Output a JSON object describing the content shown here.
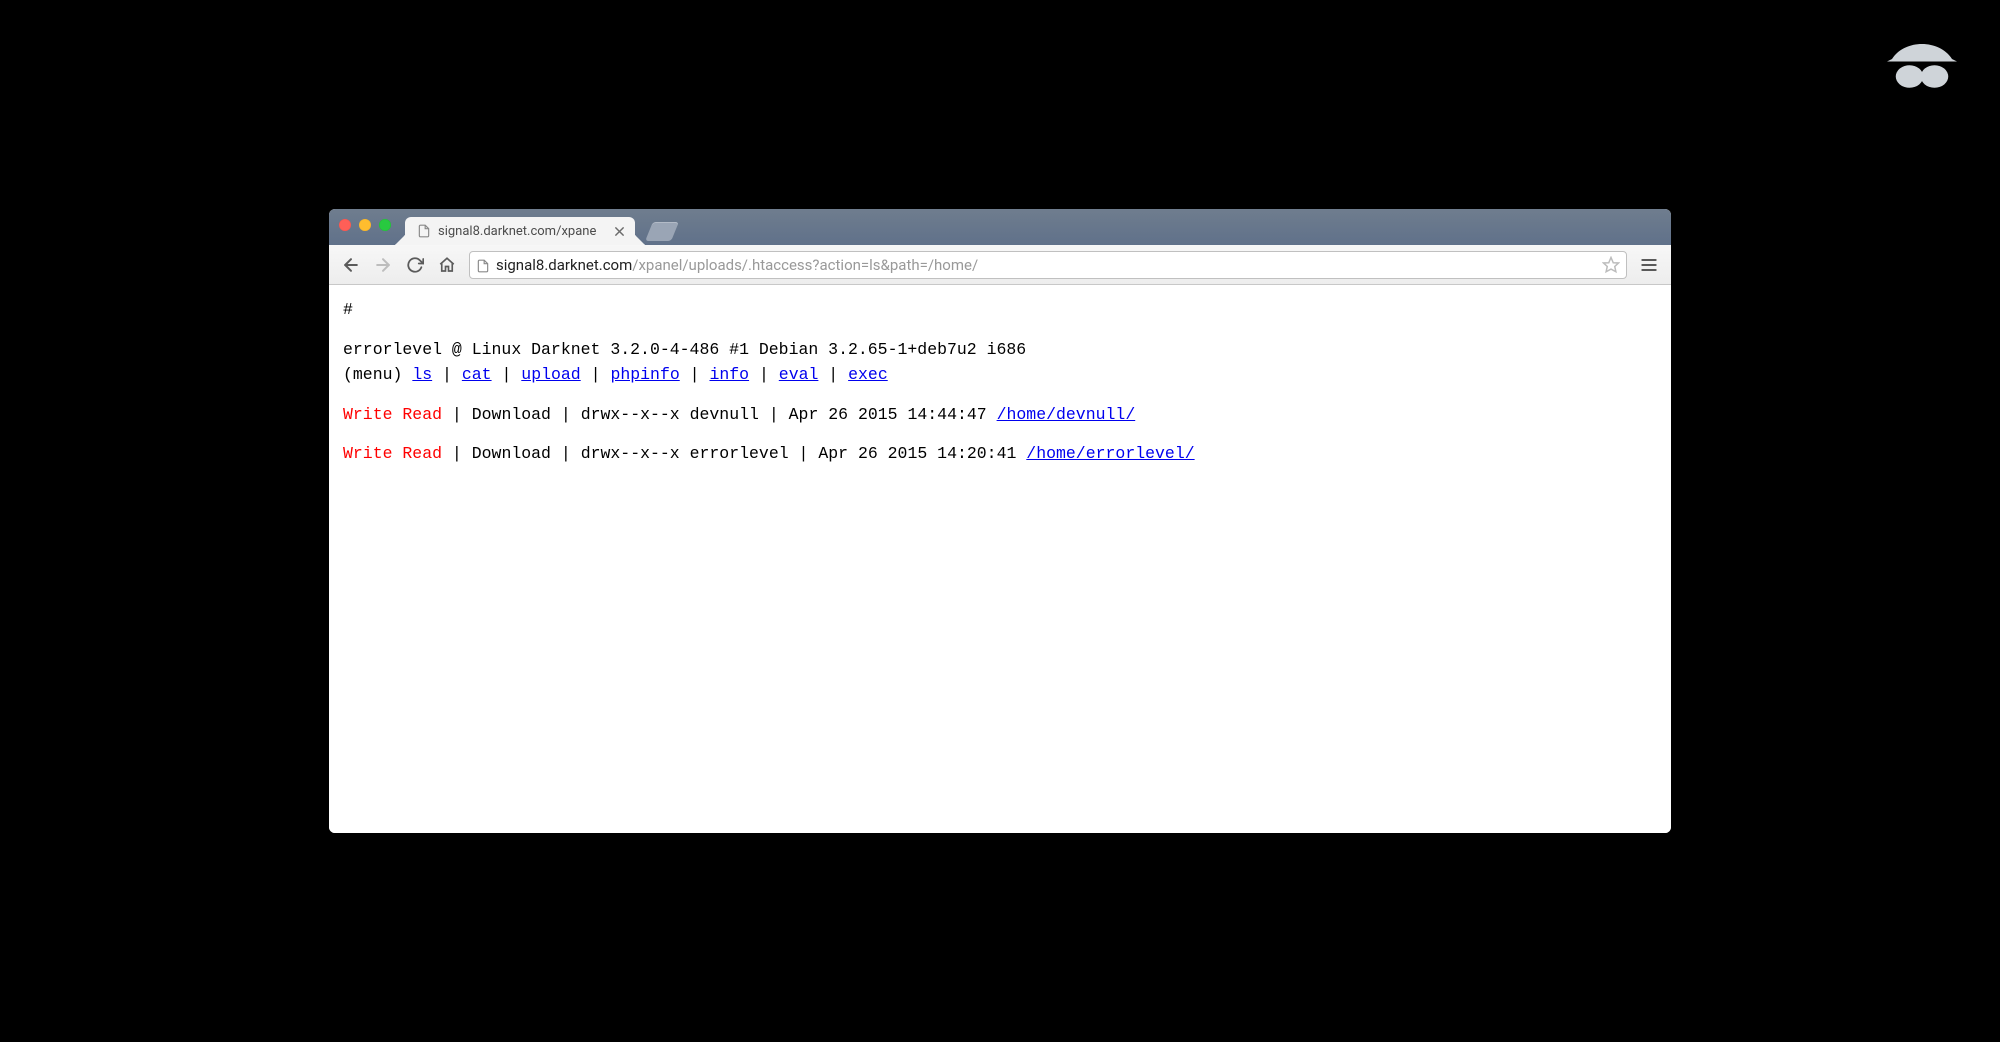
{
  "tab": {
    "title": "signal8.darknet.com/xpane"
  },
  "url": {
    "host": "signal8.darknet.com",
    "path": "/xpanel/uploads/.htaccess?action=ls&path=/home/"
  },
  "page": {
    "prompt": "#",
    "banner": "errorlevel @ Linux Darknet 3.2.0-4-486 #1 Debian 3.2.65-1+deb7u2 i686",
    "menu_label": "(menu)",
    "menu_items": [
      "ls",
      "cat",
      "upload",
      "phpinfo",
      "info",
      "eval",
      "exec"
    ],
    "sep": " | ",
    "rows": [
      {
        "perms_label": "Write Read",
        "download": "Download",
        "mode_owner": "drwx--x--x devnull",
        "datetime": "Apr 26 2015 14:44:47",
        "path": "/home/devnull/"
      },
      {
        "perms_label": "Write Read",
        "download": "Download",
        "mode_owner": "drwx--x--x errorlevel",
        "datetime": "Apr 26 2015 14:20:41",
        "path": "/home/errorlevel/"
      }
    ]
  }
}
